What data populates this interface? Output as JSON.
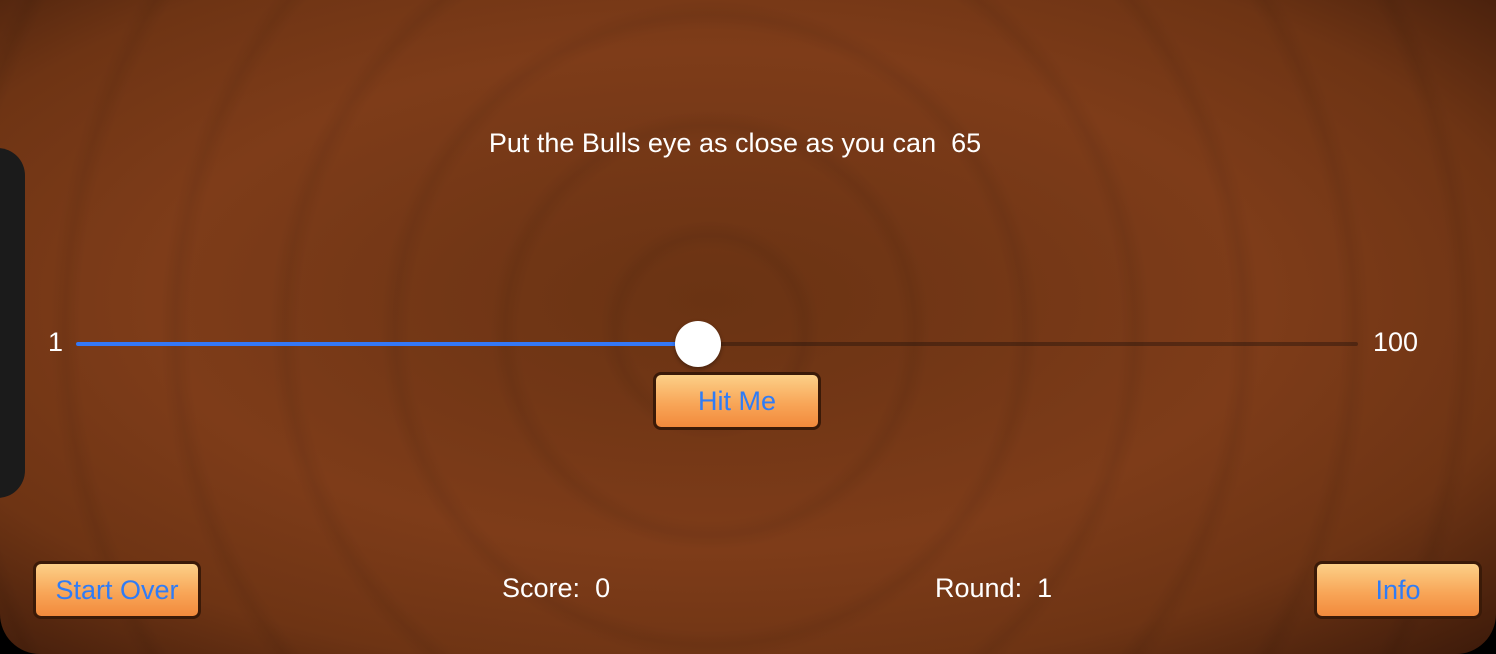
{
  "game": {
    "instruction": "Put the Bulls eye as close as you can",
    "target": "65",
    "slider": {
      "min_label": "1",
      "max_label": "100",
      "min": 1,
      "max": 100,
      "value": 49
    },
    "hit_button": "Hit Me",
    "start_over_button": "Start Over",
    "info_button": "Info",
    "score_label": "Score:",
    "score_value": "0",
    "round_label": "Round:",
    "round_value": "1"
  },
  "colors": {
    "accent": "#3478f6",
    "button_top": "#fcd088",
    "button_bottom": "#f28a3c",
    "background": "#7a3a18"
  }
}
